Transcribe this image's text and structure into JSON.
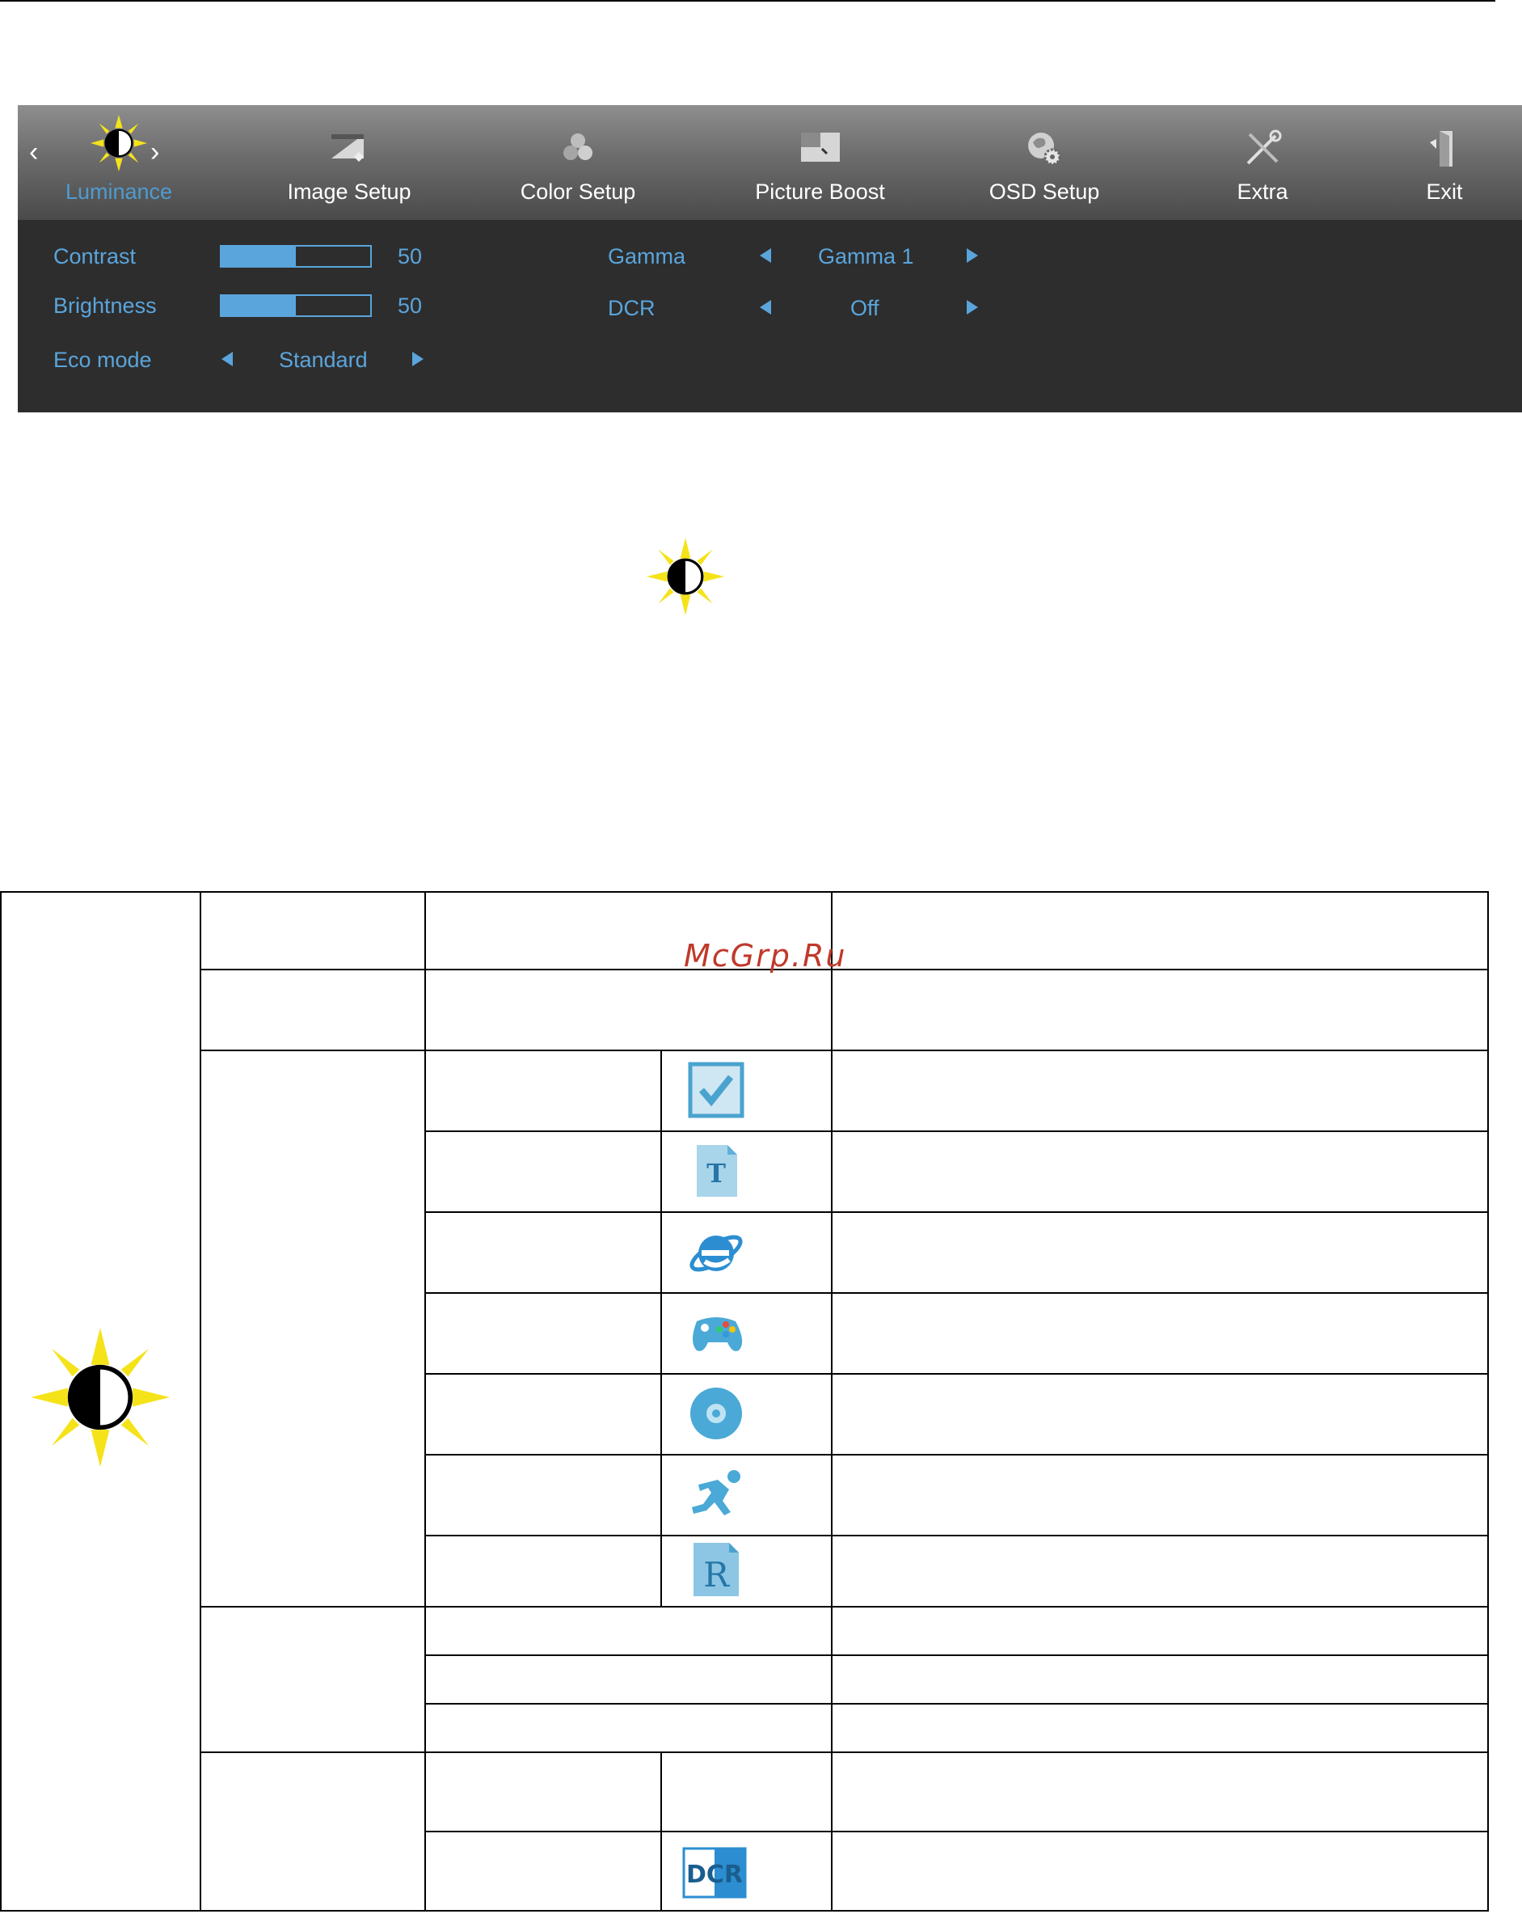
{
  "osd": {
    "tabs": [
      {
        "label": "Luminance",
        "icon": "luminance-sun-icon",
        "active": true
      },
      {
        "label": "Image Setup",
        "icon": "image-setup-icon",
        "active": false
      },
      {
        "label": "Color Setup",
        "icon": "color-setup-icon",
        "active": false
      },
      {
        "label": "Picture Boost",
        "icon": "picture-boost-icon",
        "active": false
      },
      {
        "label": "OSD Setup",
        "icon": "osd-setup-icon",
        "active": false
      },
      {
        "label": "Extra",
        "icon": "extra-tools-icon",
        "active": false
      },
      {
        "label": "Exit",
        "icon": "exit-door-icon",
        "active": false
      }
    ],
    "settings": {
      "contrast": {
        "label": "Contrast",
        "value": "50",
        "level": 0.5
      },
      "brightness": {
        "label": "Brightness",
        "value": "50",
        "level": 0.5
      },
      "eco_mode": {
        "label": "Eco mode",
        "value": "Standard"
      },
      "gamma": {
        "label": "Gamma",
        "value": "Gamma 1"
      },
      "dcr": {
        "label": "DCR",
        "value": "Off"
      }
    },
    "colors": {
      "accent": "#5aa5dc",
      "panel": "#2d2d2d",
      "sun": "#f5e31a"
    }
  },
  "watermark": "McGrp.Ru",
  "table_icons": [
    "luminance-sun-icon",
    "standard-check-icon",
    "text-t-icon",
    "internet-e-icon",
    "game-controller-icon",
    "movie-disc-icon",
    "sports-runner-icon",
    "srgb-r-icon",
    "dcr-icon"
  ]
}
